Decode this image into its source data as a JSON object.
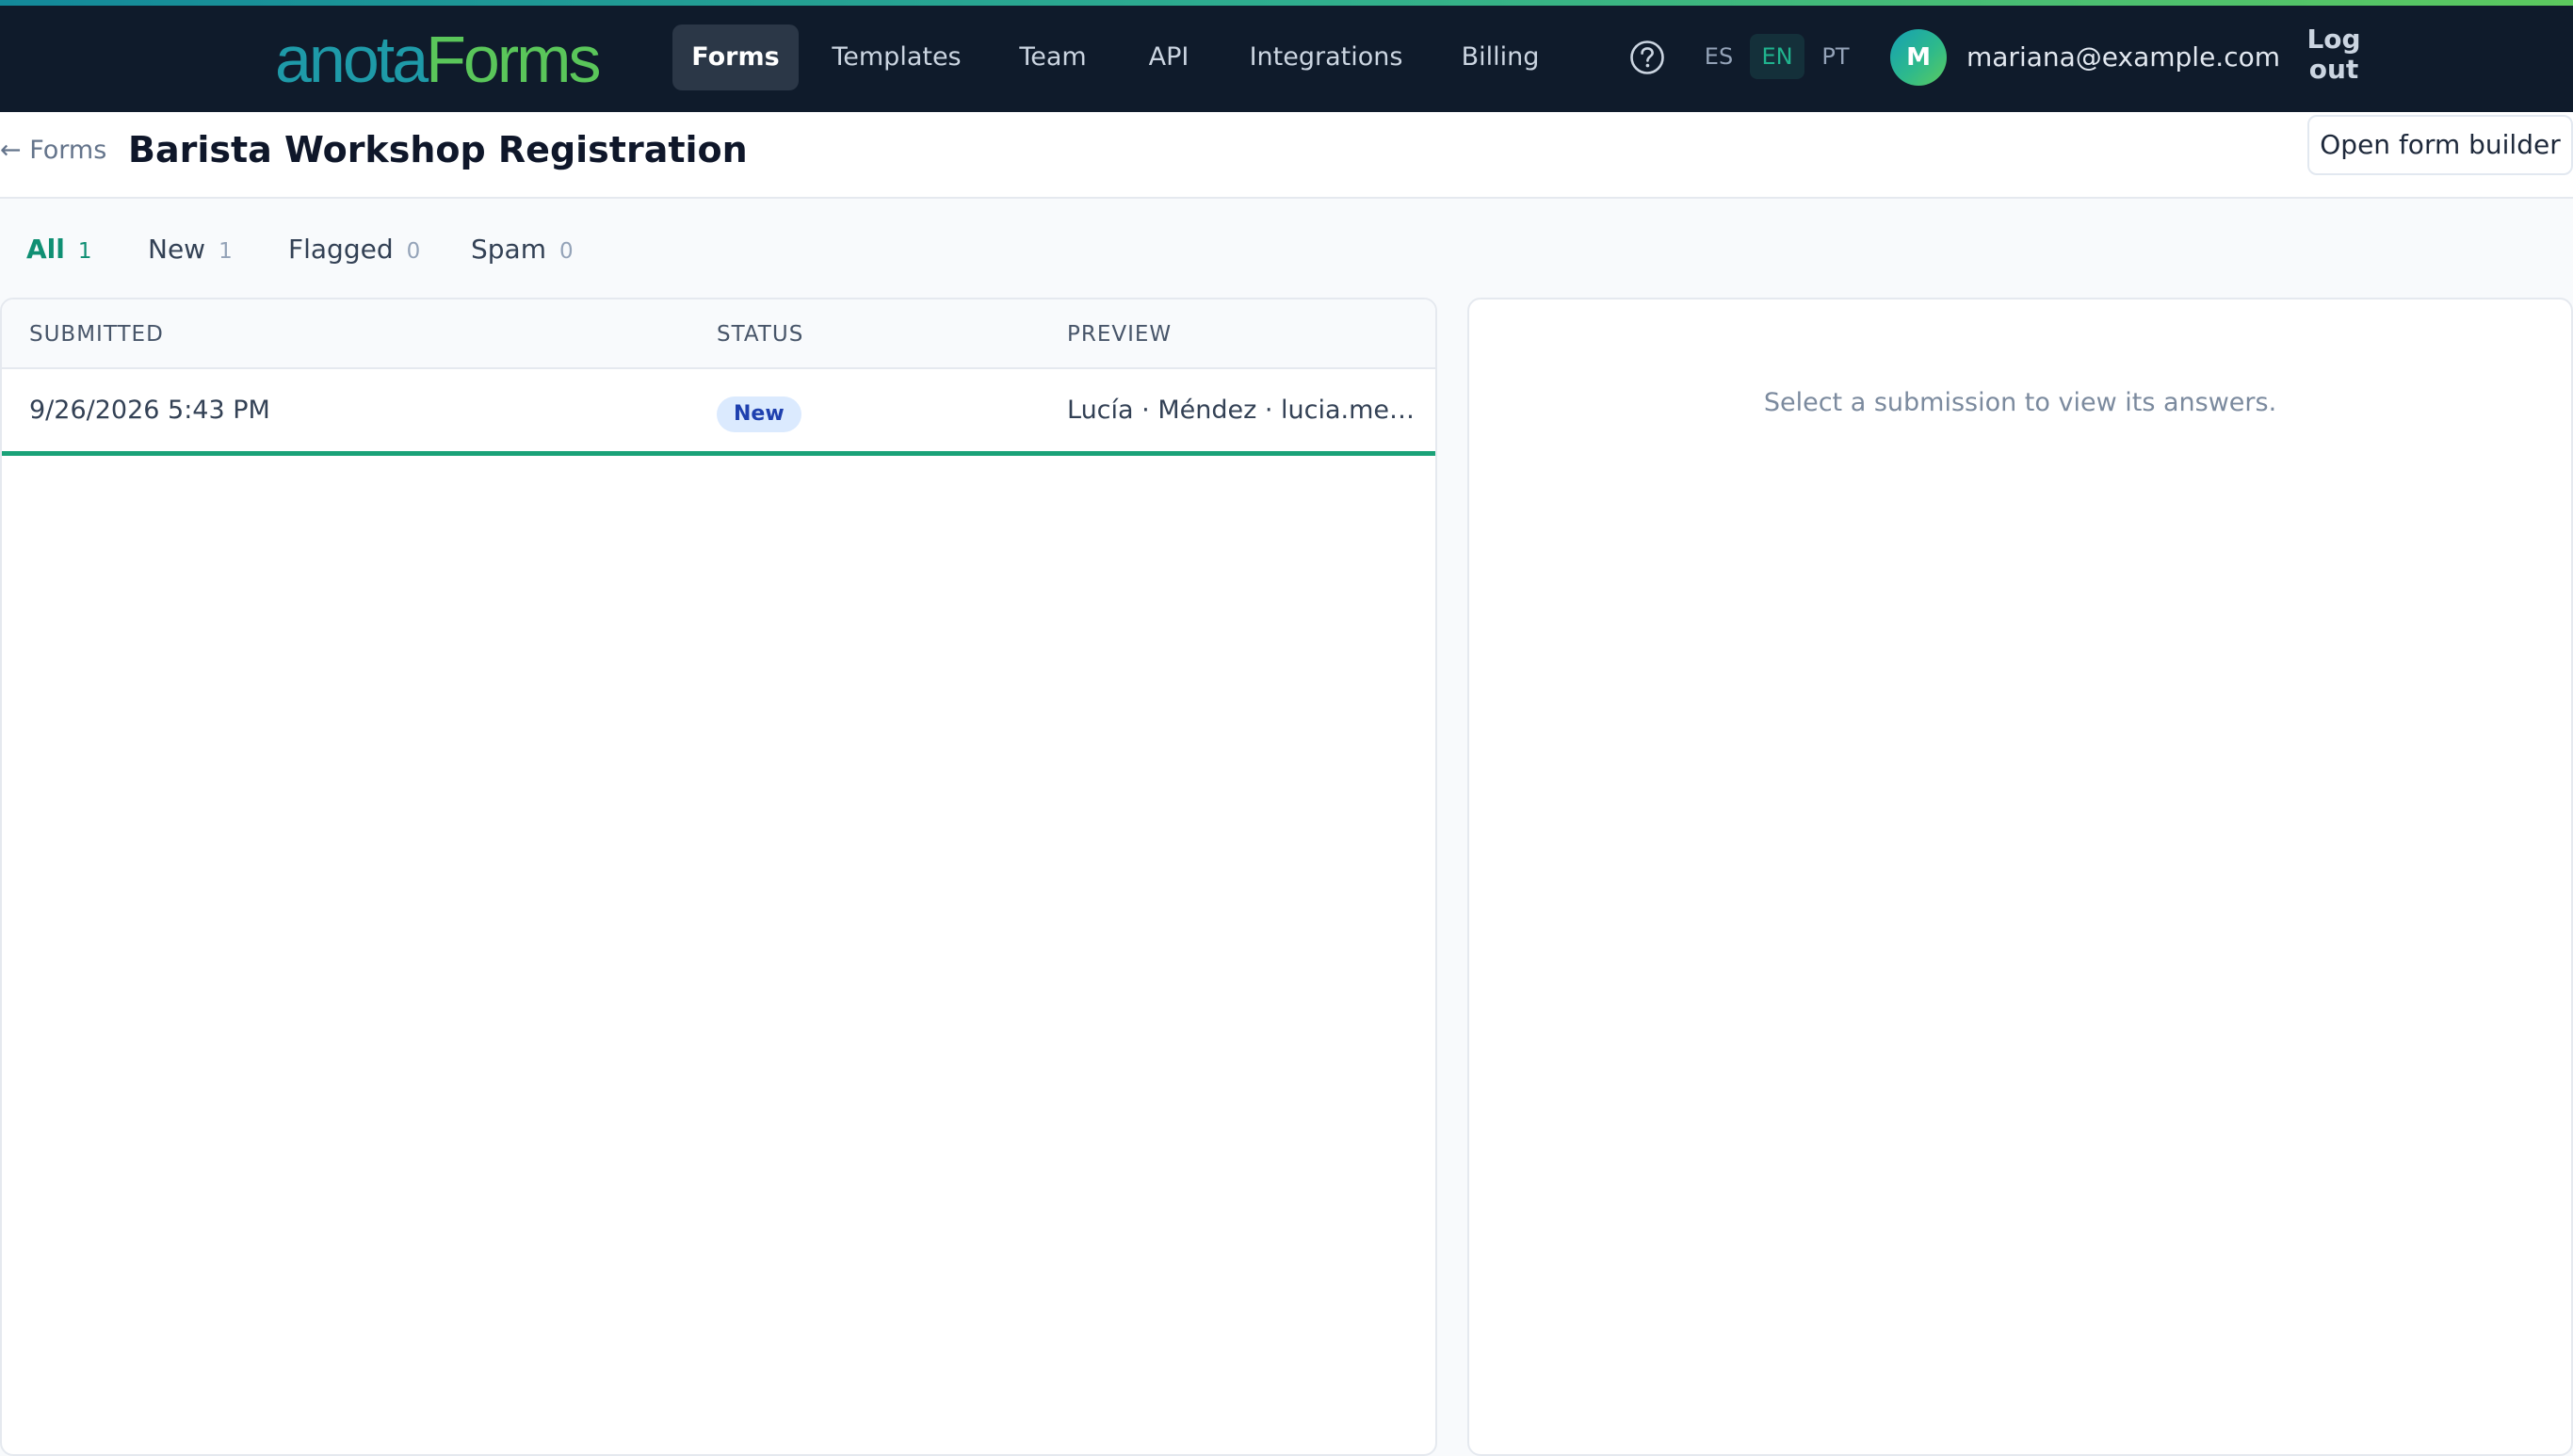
{
  "brand": {
    "logo_part1": "anota",
    "logo_part2": "Forms",
    "colors": {
      "primary": "#1e9aa8",
      "secondary": "#5ac65a",
      "nav_bg": "#0f1b2b"
    }
  },
  "nav": {
    "items": [
      {
        "label": "Forms",
        "active": true
      },
      {
        "label": "Templates",
        "active": false
      },
      {
        "label": "Team",
        "active": false
      },
      {
        "label": "API",
        "active": false
      },
      {
        "label": "Integrations",
        "active": false
      },
      {
        "label": "Billing",
        "active": false
      }
    ],
    "help_icon": "help-circle-icon",
    "languages": [
      {
        "code": "ES",
        "active": false
      },
      {
        "code": "EN",
        "active": true
      },
      {
        "code": "PT",
        "active": false
      }
    ],
    "user": {
      "avatar_initial": "M",
      "email": "mariana@example.com"
    },
    "logout_label": "Log out"
  },
  "page": {
    "back_label": "← Forms",
    "title": "Barista Workshop Registration",
    "builder_button": "Open form builder"
  },
  "filters": [
    {
      "label": "All",
      "count": "1",
      "active": true
    },
    {
      "label": "New",
      "count": "1",
      "active": false
    },
    {
      "label": "Flagged",
      "count": "0",
      "active": false
    },
    {
      "label": "Spam",
      "count": "0",
      "active": false
    }
  ],
  "table": {
    "columns": [
      "SUBMITTED",
      "STATUS",
      "PREVIEW"
    ],
    "rows": [
      {
        "submitted": "9/26/2026 5:43 PM",
        "status": "New",
        "preview": "Lucía · Méndez · lucia.mendez@example.com"
      }
    ]
  },
  "detail": {
    "empty_message": "Select a submission to view its answers."
  }
}
